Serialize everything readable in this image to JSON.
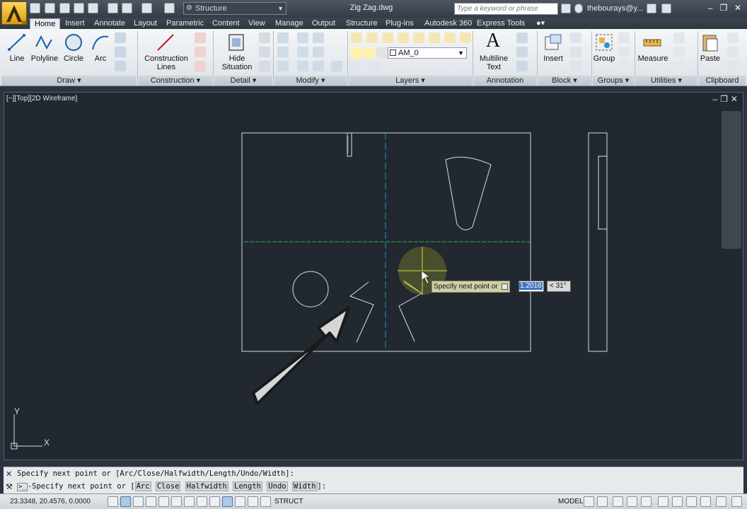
{
  "title_bar": {
    "workspace": "Structure",
    "document_title": "Zig Zag.dwg",
    "search_placeholder": "Type a keyword or phrase",
    "user": "thebourays@y..."
  },
  "tabs": [
    "Home",
    "Insert",
    "Annotate",
    "Layout",
    "Parametric",
    "Content",
    "View",
    "Manage",
    "Output",
    "Structure",
    "Plug-ins",
    "Autodesk 360",
    "Express Tools"
  ],
  "ribbon": {
    "draw": {
      "line": "Line",
      "polyline": "Polyline",
      "circle": "Circle",
      "arc": "Arc",
      "title": "Draw"
    },
    "construction": {
      "label_1": "Construction",
      "label_2": "Lines",
      "title": "Construction"
    },
    "detail": {
      "label_1": "Hide",
      "label_2": "Situation",
      "title": "Detail"
    },
    "modify": {
      "title": "Modify"
    },
    "layers": {
      "current_layer": "AM_0",
      "title": "Layers"
    },
    "annotation": {
      "label_1": "Multiline",
      "label_2": "Text",
      "title": "Annotation"
    },
    "block": {
      "insert": "Insert",
      "title": "Block"
    },
    "groups": {
      "group": "Group",
      "title": "Groups"
    },
    "utilities": {
      "measure": "Measure",
      "title": "Utilities"
    },
    "clipboard": {
      "paste": "Paste",
      "title": "Clipboard"
    }
  },
  "viewport": {
    "label": "[−][Top][2D Wireframe]",
    "tooltip_prompt": "Specify next point or",
    "length_value": "1.2016",
    "angle_value": "< 31°",
    "ucs_x": "X",
    "ucs_y": "Y"
  },
  "command_line": {
    "history": "Specify next point or [Arc/Close/Halfwidth/Length/Undo/Width]:",
    "prompt_prefix": "-Specify next point or [",
    "options": [
      "Arc",
      "Close",
      "Halfwidth",
      "Length",
      "Undo",
      "Width"
    ],
    "prompt_suffix": "]:"
  },
  "status_bar": {
    "coordinates": "23.3348, 20.4576, 0.0000",
    "struct_label": "STRUCT",
    "model_label": "MODEL"
  },
  "colors": {
    "title_bar": "#343b45",
    "viewport_bg": "#212830",
    "accent_yellow": "#d8d84a",
    "centerline": "#2a8fb0",
    "grid_line": "#2fb24a"
  }
}
